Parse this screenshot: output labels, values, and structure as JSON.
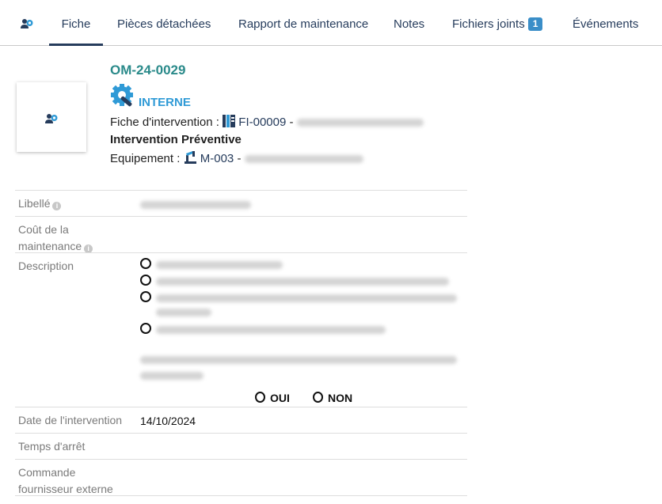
{
  "tabs": [
    {
      "label": "Fiche"
    },
    {
      "label": "Pièces détachées"
    },
    {
      "label": "Rapport de maintenance"
    },
    {
      "label": "Notes"
    },
    {
      "label": "Fichiers joints",
      "badge": "1"
    },
    {
      "label": "Événements"
    }
  ],
  "active_tab": "Fiche",
  "header": {
    "ref": "OM-24-0029",
    "type": "INTERNE",
    "fiche_label": "Fiche d'intervention :",
    "fiche_ref": "FI-00009",
    "fiche_sep": "-",
    "title": "Intervention Préventive",
    "equip_label": "Equipement :",
    "equip_ref": "M-003",
    "equip_sep": "-"
  },
  "fields": {
    "libelle_label": "Libellé",
    "cout_label": "Coût de la maintenance",
    "description_label": "Description",
    "choice_yes": "OUI",
    "choice_no": "NON",
    "date_label": "Date de l'intervention",
    "date_value": "14/10/2024",
    "arret_label": "Temps d'arrêt",
    "commande_label": "Commande fournisseur externe"
  },
  "colors": {
    "accent": "#263c5c",
    "ref": "#2a8a8a",
    "type": "#2f9ad6",
    "badge": "#3a8ec8"
  }
}
